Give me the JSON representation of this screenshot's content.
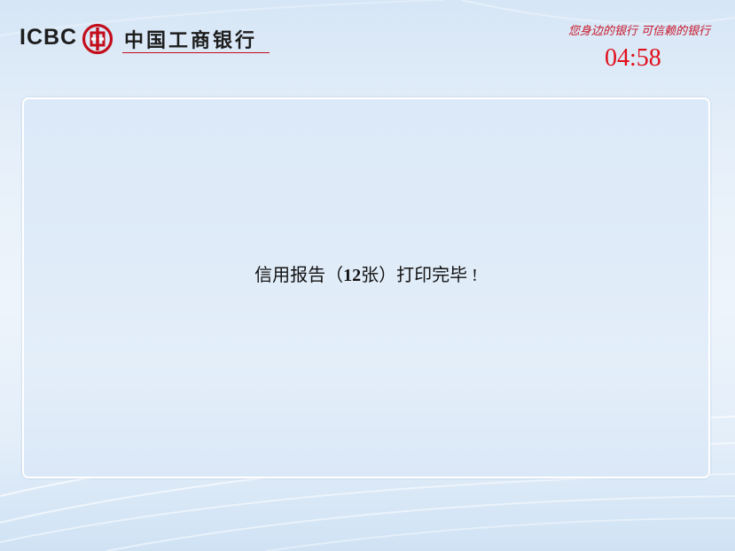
{
  "header": {
    "logo_latin": "ICBC",
    "logo_chinese": "中国工商银行",
    "slogan": "您身边的银行  可信赖的银行",
    "countdown": "04:58"
  },
  "main": {
    "message_prefix": "信用报告（",
    "message_count": "12",
    "message_suffix": "张）打印完毕 !"
  },
  "colors": {
    "brand_red": "#c8162a",
    "timer_red": "#e0101c",
    "background": "#e7f0fa"
  },
  "icons": {
    "logo_emblem": "icbc-emblem-icon"
  }
}
